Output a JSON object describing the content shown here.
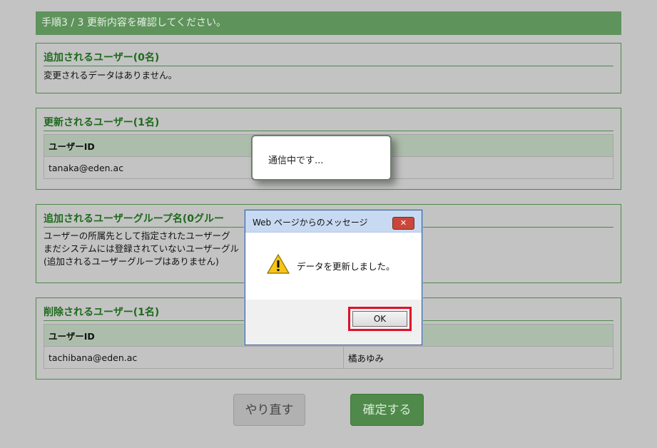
{
  "step_bar": {
    "text": "手順3 / 3 更新内容を確認してください。"
  },
  "sections": {
    "added": {
      "title": "追加されるユーザー(0名)",
      "message": "変更されるデータはありません。"
    },
    "updated": {
      "title": "更新されるユーザー(1名)",
      "columns": [
        "ユーザーID"
      ],
      "rows": [
        [
          "tanaka@eden.ac"
        ]
      ]
    },
    "groups": {
      "title": "追加されるユーザーグループ名(0グルー",
      "lines": [
        "ユーザーの所属先として指定されたユーザーグ",
        "まだシステムには登録されていないユーザーグル",
        "(追加されるユーザーグループはありません)"
      ]
    },
    "deleted": {
      "title": "削除されるユーザー(1名)",
      "columns": [
        "ユーザーID"
      ],
      "rows": [
        [
          "tachibana@eden.ac",
          "橘あゆみ"
        ]
      ]
    }
  },
  "buttons": {
    "redo": "やり直す",
    "confirm": "確定する"
  },
  "loading": {
    "text": "通信中です..."
  },
  "dialog": {
    "title": "Web ページからのメッセージ",
    "close_symbol": "✕",
    "message": "データを更新しました。",
    "ok_label": "OK",
    "icon": "warning-icon",
    "highlight_color": "#e0102a"
  }
}
